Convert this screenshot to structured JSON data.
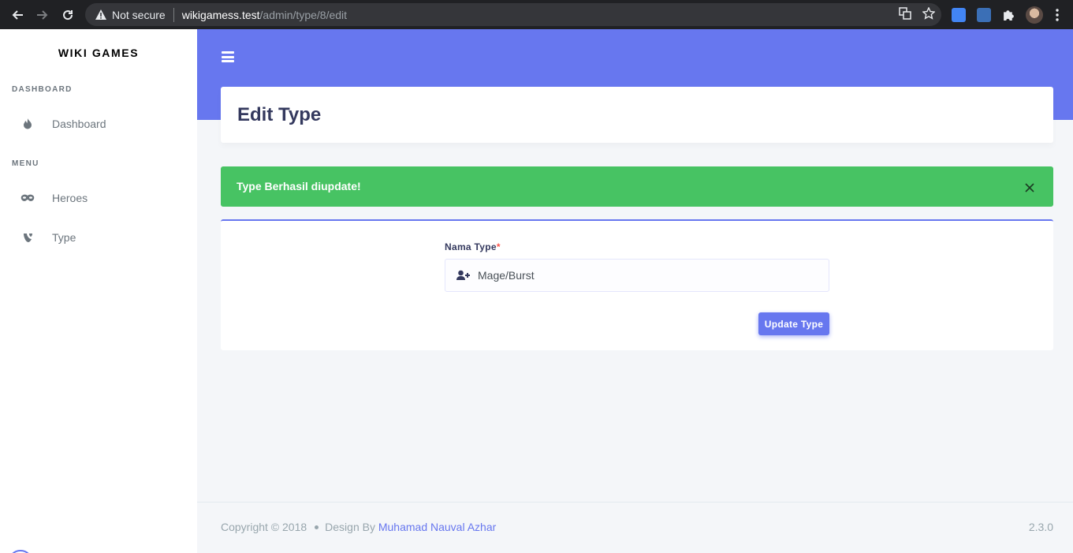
{
  "browser": {
    "security_label": "Not secure",
    "url_host": "wikigamess.test",
    "url_path": "/admin/type/8/edit"
  },
  "sidebar": {
    "brand": "WIKI GAMES",
    "sections": [
      {
        "header": "DASHBOARD",
        "items": [
          {
            "label": "Dashboard",
            "icon": "fire-icon"
          }
        ]
      },
      {
        "header": "MENU",
        "items": [
          {
            "label": "Heroes",
            "icon": "mask-icon"
          },
          {
            "label": "Type",
            "icon": "typo3-icon"
          }
        ]
      }
    ]
  },
  "page": {
    "title": "Edit Type"
  },
  "alert": {
    "message": "Type Berhasil diupdate!",
    "status_color": "#47c363"
  },
  "form": {
    "label": "Nama Type",
    "required_mark": "*",
    "value": "Mage/Burst",
    "submit_label": "Update Type"
  },
  "footer": {
    "copyright": "Copyright © 2018",
    "design_by": "Design By",
    "author": "Muhamad Nauval Azhar",
    "version": "2.3.0"
  },
  "colors": {
    "primary": "#6777ef",
    "success": "#47c363",
    "browser_bar": "#202124"
  }
}
